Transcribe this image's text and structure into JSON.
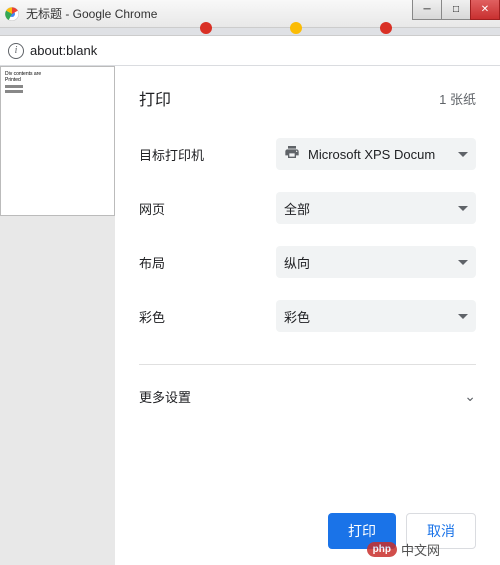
{
  "window": {
    "title": "无标题 - Google Chrome"
  },
  "address": {
    "url": "about:blank"
  },
  "preview": {
    "line1": "Div contents are",
    "line2": "Printed"
  },
  "print": {
    "title": "打印",
    "sheet_count": "1 张纸",
    "rows": {
      "destination": {
        "label": "目标打印机",
        "value": "Microsoft XPS Docum"
      },
      "pages": {
        "label": "网页",
        "value": "全部"
      },
      "layout": {
        "label": "布局",
        "value": "纵向"
      },
      "color": {
        "label": "彩色",
        "value": "彩色"
      }
    },
    "more_settings": "更多设置",
    "buttons": {
      "print": "打印",
      "cancel": "取消"
    }
  },
  "watermark": {
    "badge": "php",
    "text": "中文网"
  }
}
